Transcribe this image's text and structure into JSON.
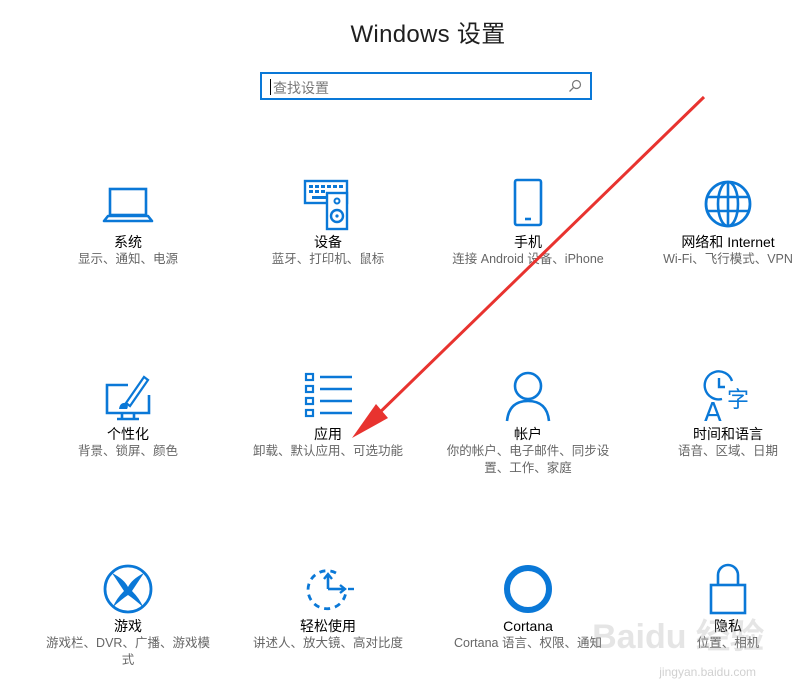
{
  "window": {
    "title": "Windows 设置"
  },
  "search": {
    "placeholder": "查找设置",
    "icon": "search-icon"
  },
  "accent": "#0a78d7",
  "annotation_color": "#e8332f",
  "tiles": [
    {
      "name": "系统",
      "desc": "显示、通知、电源",
      "icon": "laptop-icon"
    },
    {
      "name": "设备",
      "desc": "蓝牙、打印机、鼠标",
      "icon": "keyboard-speaker-icon"
    },
    {
      "name": "手机",
      "desc": "连接 Android 设备、iPhone",
      "icon": "phone-icon"
    },
    {
      "name": "网络和 Internet",
      "desc": "Wi-Fi、飞行模式、VPN",
      "icon": "globe-icon"
    },
    {
      "name": "个性化",
      "desc": "背景、锁屏、颜色",
      "icon": "paint-brush-icon"
    },
    {
      "name": "应用",
      "desc": "卸载、默认应用、可选功能",
      "icon": "app-list-icon"
    },
    {
      "name": "帐户",
      "desc": "你的帐户、电子邮件、同步设置、工作、家庭",
      "icon": "person-icon"
    },
    {
      "name": "时间和语言",
      "desc": "语音、区域、日期",
      "icon": "time-language-icon"
    },
    {
      "name": "游戏",
      "desc": "游戏栏、DVR、广播、游戏模式",
      "icon": "xbox-icon"
    },
    {
      "name": "轻松使用",
      "desc": "讲述人、放大镜、高对比度",
      "icon": "ease-of-access-icon"
    },
    {
      "name": "Cortana",
      "desc": "Cortana 语言、权限、通知",
      "icon": "cortana-icon"
    },
    {
      "name": "隐私",
      "desc": "位置、相机",
      "icon": "lock-icon"
    }
  ],
  "watermark": {
    "main": "Baidu 经验",
    "sub": "jingyan.baidu.com"
  }
}
